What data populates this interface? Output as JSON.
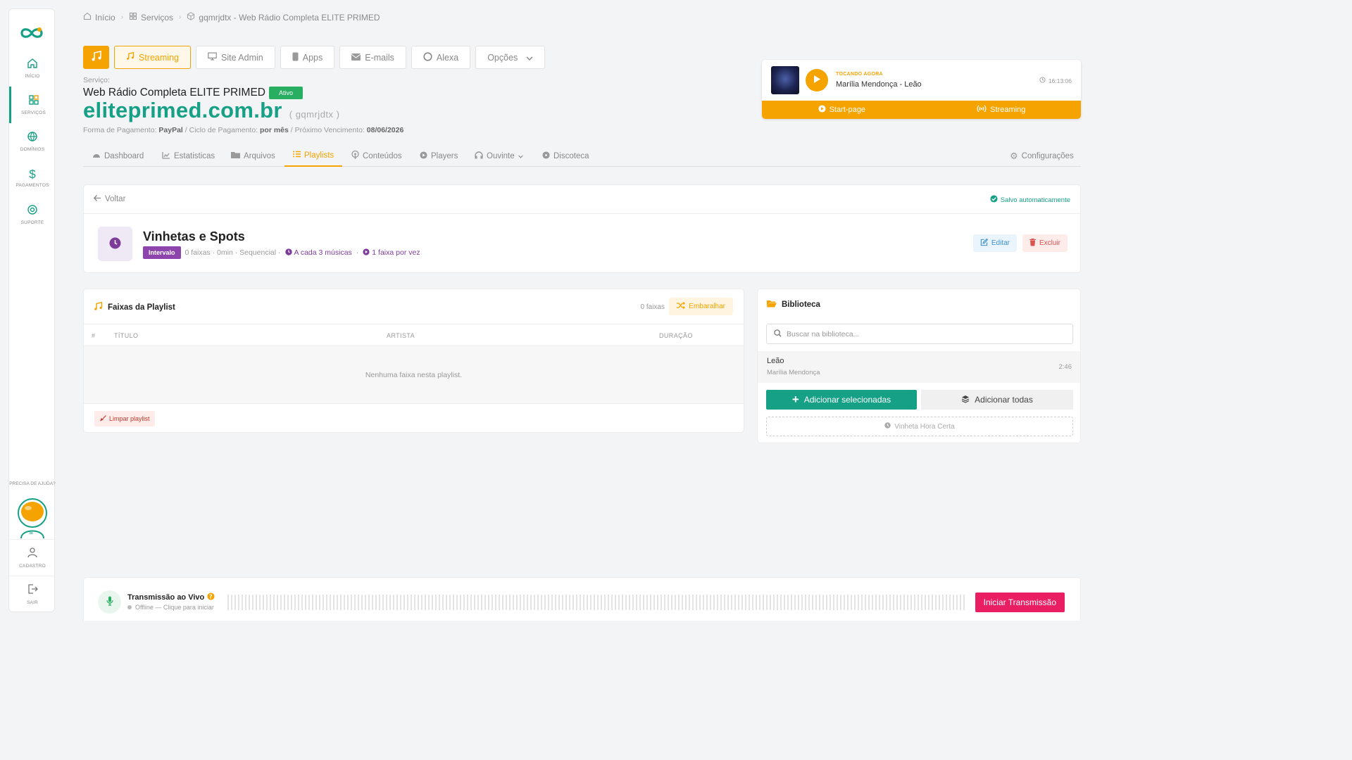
{
  "sidebar": {
    "items": [
      {
        "label": "INÍCIO",
        "icon": "home-icon"
      },
      {
        "label": "SERVIÇOS",
        "icon": "grid-icon"
      },
      {
        "label": "DOMÍNIOS",
        "icon": "globe-icon"
      },
      {
        "label": "PAGAMENTOS",
        "icon": "dollar-icon"
      },
      {
        "label": "SUPORTE",
        "icon": "lifebuoy-icon"
      }
    ],
    "help": "PRECISA DE AJUDA?",
    "cadastro": "CADASTRO",
    "sair": "SAIR"
  },
  "breadcrumb": {
    "home": "Início",
    "services": "Serviços",
    "current": "gqmrjdtx - Web Rádio Completa ELITE PRIMED"
  },
  "toolbar": {
    "streaming": "Streaming",
    "site_admin": "Site Admin",
    "apps": "Apps",
    "emails": "E-mails",
    "alexa": "Alexa",
    "opcoes": "Opções"
  },
  "service": {
    "label": "Serviço:",
    "name": "Web Rádio Completa ELITE PRIMED",
    "status": "Ativo",
    "domain": "eliteprimed.com.br",
    "code": "( gqmrjdtx )",
    "payment_label": "Forma de Pagamento:",
    "payment_value": "PayPal",
    "cycle_label": "/ Ciclo de Pagamento:",
    "cycle_value": "por mês",
    "due_label": "/ Próximo Vencimento:",
    "due_value": "08/06/2026"
  },
  "now_playing": {
    "tag": "TOCANDO AGORA",
    "title": "Marília Mendonça - Leão",
    "time": "16:13:06",
    "start_page": "Start-page",
    "streaming": "Streaming"
  },
  "tabs": [
    {
      "label": "Dashboard"
    },
    {
      "label": "Estatisticas"
    },
    {
      "label": "Arquivos"
    },
    {
      "label": "Playlists"
    },
    {
      "label": "Conteúdos"
    },
    {
      "label": "Players"
    },
    {
      "label": "Ouvinte"
    },
    {
      "label": "Discoteca"
    },
    {
      "label": "Configurações"
    }
  ],
  "playlist": {
    "back": "Voltar",
    "saved": "Salvo automaticamente",
    "title": "Vinhetas e Spots",
    "type": "Intervalo",
    "meta": "0 faixas · 0min · Sequencial ·",
    "interval": "A cada 3 músicas",
    "dot": "·",
    "per_turn": "1 faixa por vez",
    "edit": "Editar",
    "delete": "Excluir"
  },
  "tracks": {
    "title": "Faixas da Playlist",
    "count": "0 faixas",
    "shuffle": "Embaralhar",
    "columns": {
      "num": "#",
      "title": "TÍTULO",
      "artist": "ARTISTA",
      "duration": "DURAÇÃO"
    },
    "empty": "Nenhuma faixa nesta playlist.",
    "clear": "Limpar playlist"
  },
  "library": {
    "title": "Biblioteca",
    "search_placeholder": "Buscar na biblioteca...",
    "items": [
      {
        "title": "Leão",
        "artist": "Marília Mendonça",
        "duration": "2:46"
      }
    ],
    "add_selected": "Adicionar selecionadas",
    "add_all": "Adicionar todas",
    "vinheta": "Vinheta Hora Certa"
  },
  "live": {
    "title": "Transmissão ao Vivo",
    "status": "Offline — Clique para iniciar",
    "start": "Iniciar Transmissão"
  },
  "colors": {
    "accent": "#f5a300",
    "brand": "#16a085",
    "purple": "#8e44ad",
    "danger": "#e91e63"
  }
}
